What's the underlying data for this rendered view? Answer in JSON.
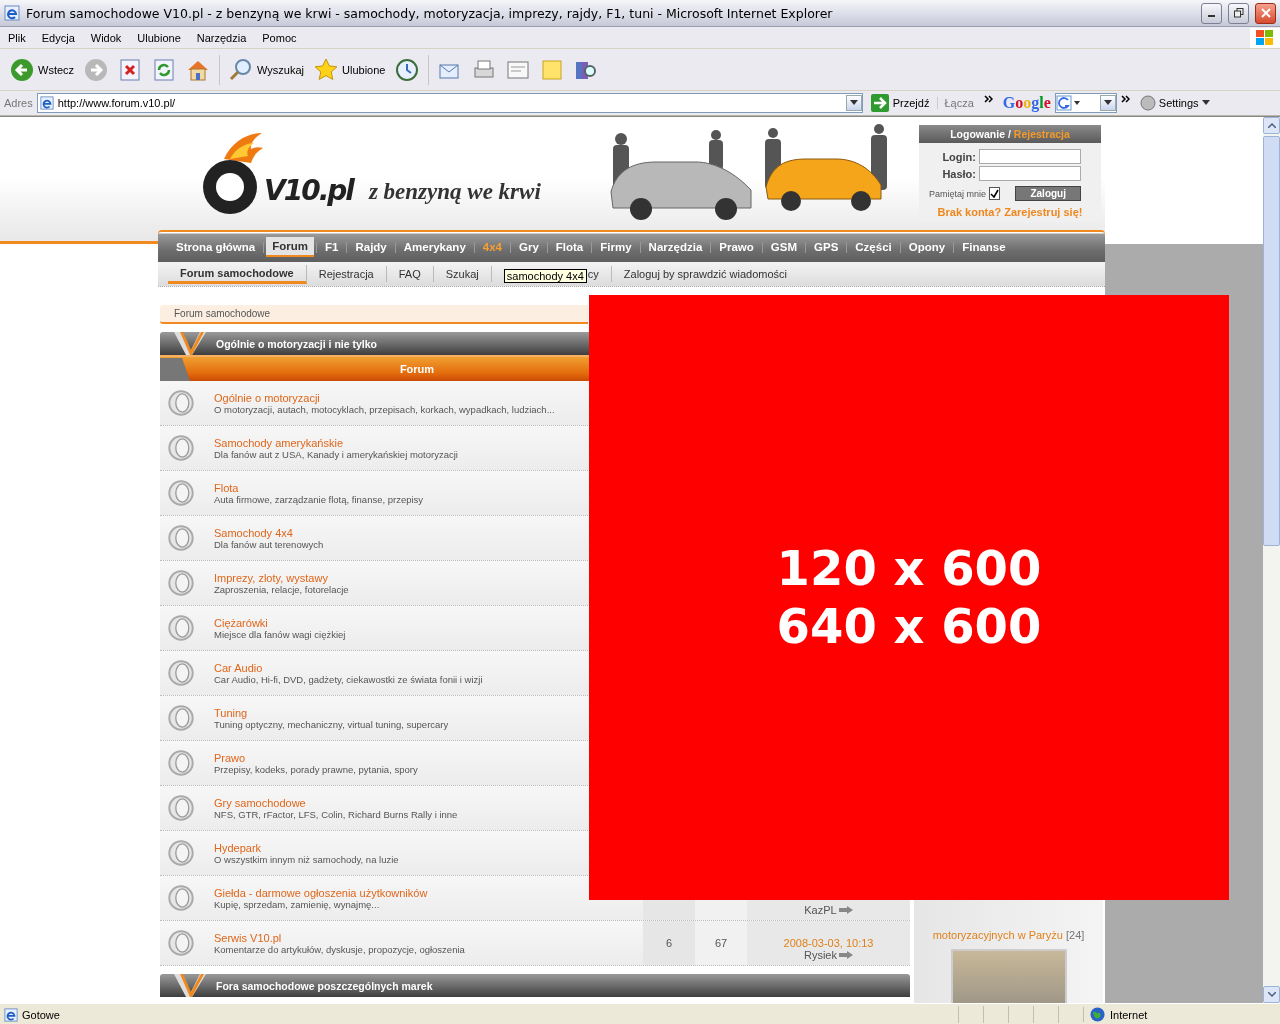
{
  "window": {
    "title": "Forum samochodowe V10.pl - z benzyną we krwi - samochody, motoryzacja, imprezy, rajdy, F1, tuni - Microsoft Internet Explorer"
  },
  "menu": [
    "Plik",
    "Edycja",
    "Widok",
    "Ulubione",
    "Narzędzia",
    "Pomoc"
  ],
  "toolbar": [
    {
      "kind": "back",
      "label": "Wstecz"
    },
    {
      "kind": "forward"
    },
    {
      "kind": "stop"
    },
    {
      "kind": "refresh"
    },
    {
      "kind": "home"
    },
    {
      "kind": "search",
      "label": "Wyszukaj"
    },
    {
      "kind": "favorites",
      "label": "Ulubione"
    },
    {
      "kind": "history"
    },
    {
      "kind": "mail"
    },
    {
      "kind": "print"
    },
    {
      "kind": "edit"
    },
    {
      "kind": "notes"
    },
    {
      "kind": "research"
    }
  ],
  "address": {
    "label": "Adres",
    "url": "http://www.forum.v10.pl/",
    "go": "Przejdź",
    "links": "Łącza",
    "google": "Google",
    "settings": "Settings"
  },
  "site": {
    "logo": "V10.pl",
    "tagline": "z benzyną we krwi"
  },
  "login": {
    "title": "Logowanie /",
    "register_link": "Rejestracja",
    "login_label": "Login:",
    "password_label": "Hasło:",
    "remember": "Pamiętaj mnie",
    "remember_checked": true,
    "submit": "Zaloguj",
    "signup": "Brak konta? Zarejestruj się!"
  },
  "nav": [
    {
      "label": "Strona główna",
      "selected": false,
      "highlight": false
    },
    {
      "label": "Forum",
      "selected": true,
      "highlight": false
    },
    {
      "label": "F1",
      "selected": false,
      "highlight": false
    },
    {
      "label": "Rajdy",
      "selected": false,
      "highlight": false
    },
    {
      "label": "Amerykany",
      "selected": false,
      "highlight": false
    },
    {
      "label": "4x4",
      "selected": false,
      "highlight": true
    },
    {
      "label": "Gry",
      "selected": false,
      "highlight": false
    },
    {
      "label": "Flota",
      "selected": false,
      "highlight": false
    },
    {
      "label": "Firmy",
      "selected": false,
      "highlight": false
    },
    {
      "label": "Narzędzia",
      "selected": false,
      "highlight": false
    },
    {
      "label": "Prawo",
      "selected": false,
      "highlight": false
    },
    {
      "label": "GSM",
      "selected": false,
      "highlight": false
    },
    {
      "label": "GPS",
      "selected": false,
      "highlight": false
    },
    {
      "label": "Części",
      "selected": false,
      "highlight": false
    },
    {
      "label": "Opony",
      "selected": false,
      "highlight": false
    },
    {
      "label": "Finanse",
      "selected": false,
      "highlight": false
    }
  ],
  "subnav": [
    {
      "label": "Forum samochodowe",
      "selected": true
    },
    {
      "label": "Rejestracja",
      "selected": false
    },
    {
      "label": "FAQ",
      "selected": false
    },
    {
      "label": "Szukaj",
      "selected": false
    },
    {
      "label": "cy",
      "selected": false
    },
    {
      "label": "Zaloguj by sprawdzić wiadomości",
      "selected": false
    }
  ],
  "tooltip": "samochody 4x4",
  "breadcrumb": "Forum samochodowe",
  "sections": [
    {
      "title": "Ogólnie o motoryzacji i nie tylko",
      "column_header": "Forum",
      "forums": [
        {
          "title": "Ogólnie o motoryzacji",
          "description": "O motoryzacji, autach, motocyklach, przepisach, korkach, wypadkach, ludziach..."
        },
        {
          "title": "Samochody amerykańskie",
          "description": "Dla fanów aut z USA, Kanady i amerykańskiej motoryzacji"
        },
        {
          "title": "Flota",
          "description": "Auta firmowe, zarządzanie flotą, finanse, przepisy"
        },
        {
          "title": "Samochody 4x4",
          "description": "Dla fanów aut terenowych"
        },
        {
          "title": "Imprezy, zloty, wystawy",
          "description": "Zaproszenia, relacje, fotorelacje"
        },
        {
          "title": "Ciężarówki",
          "description": "Miejsce dla fanów wagi ciężkiej"
        },
        {
          "title": "Car Audio",
          "description": "Car Audio, Hi-fi, DVD, gadżety, ciekawostki ze świata fonii i wizji"
        },
        {
          "title": "Tuning",
          "description": "Tuning optyczny, mechaniczny, virtual tuning, supercary"
        },
        {
          "title": "Prawo",
          "description": "Przepisy, kodeks, porady prawne, pytania, spory"
        },
        {
          "title": "Gry samochodowe",
          "description": "NFS, GTR, rFactor, LFS, Colin, Richard Burns Rally i inne"
        },
        {
          "title": "Hydepark",
          "description": "O wszystkim innym niż samochody, na luzie"
        },
        {
          "title": "Giełda - darmowe ogłoszenia użytkowników",
          "description": "Kupię, sprzedam, zamienię, wynajmę...",
          "last_post_author": "KazPL"
        },
        {
          "title": "Serwis V10.pl",
          "description": "Komentarze do artykułów, dyskusje, propozycje, ogłoszenia",
          "topics": "6",
          "posts": "67",
          "last_post_date": "2008-03-03, 10:13",
          "last_post_author": "Rysiek"
        }
      ]
    },
    {
      "title": "Fora samochodowe poszczególnych marek"
    }
  ],
  "sidebar": {
    "link": "motoryzacyjnych w Paryżu",
    "count": "[24]"
  },
  "ad": {
    "lines": [
      "120 x 600",
      "640 x 600"
    ]
  },
  "status_bar": {
    "text": "Gotowe",
    "zone": "Internet"
  }
}
